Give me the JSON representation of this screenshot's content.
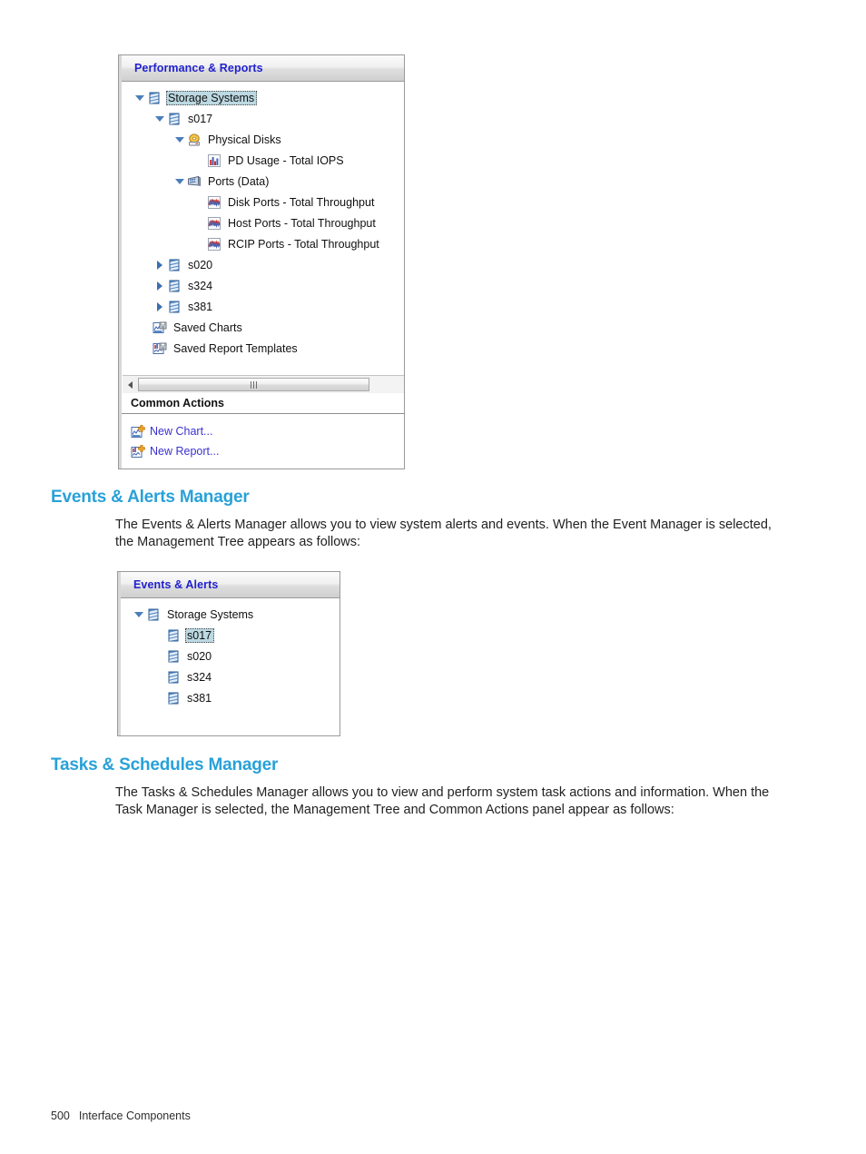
{
  "page": {
    "footer_page_number": "500",
    "footer_chapter": "Interface Components"
  },
  "performance_panel": {
    "header_title": "Performance & Reports",
    "tree": [
      {
        "label": "Storage Systems",
        "depth": 0,
        "state": "open",
        "icon": "storage-system-icon",
        "selected": true
      },
      {
        "label": "s017",
        "depth": 1,
        "state": "open",
        "icon": "storage-system-icon",
        "selected": false
      },
      {
        "label": "Physical Disks",
        "depth": 2,
        "state": "open",
        "icon": "physical-disks-icon",
        "selected": false
      },
      {
        "label": "PD Usage - Total IOPS",
        "depth": 3,
        "state": "leaf",
        "icon": "bar-chart-icon",
        "selected": false
      },
      {
        "label": "Ports (Data)",
        "depth": 2,
        "state": "open",
        "icon": "ports-data-icon",
        "selected": false
      },
      {
        "label": "Disk Ports - Total Throughput",
        "depth": 3,
        "state": "leaf",
        "icon": "line-chart-icon",
        "selected": false
      },
      {
        "label": "Host Ports - Total Throughput",
        "depth": 3,
        "state": "leaf",
        "icon": "line-chart-icon",
        "selected": false
      },
      {
        "label": "RCIP Ports - Total Throughput",
        "depth": 3,
        "state": "leaf",
        "icon": "line-chart-icon",
        "selected": false
      },
      {
        "label": "s020",
        "depth": 1,
        "state": "closed",
        "icon": "storage-system-icon",
        "selected": false
      },
      {
        "label": "s324",
        "depth": 1,
        "state": "closed",
        "icon": "storage-system-icon",
        "selected": false
      },
      {
        "label": "s381",
        "depth": 1,
        "state": "closed",
        "icon": "storage-system-icon",
        "selected": false
      },
      {
        "label": "Saved Charts",
        "depth": 1,
        "state": "leaf-noindent",
        "icon": "saved-charts-icon",
        "selected": false
      },
      {
        "label": "Saved Report Templates",
        "depth": 1,
        "state": "leaf-noindent",
        "icon": "saved-reports-icon",
        "selected": false
      }
    ],
    "common_actions": {
      "title": "Common Actions",
      "items": [
        {
          "label": "New Chart...",
          "icon": "new-chart-icon"
        },
        {
          "label": "New Report...",
          "icon": "new-report-icon"
        }
      ]
    }
  },
  "events_section": {
    "heading": "Events & Alerts Manager",
    "paragraph": "The Events & Alerts Manager allows you to view system alerts and events. When the Event Manager is selected, the Management Tree appears as follows:"
  },
  "events_panel": {
    "header_title": "Events & Alerts",
    "tree": [
      {
        "label": "Storage Systems",
        "depth": 0,
        "state": "open",
        "icon": "storage-system-icon",
        "selected": false
      },
      {
        "label": "s017",
        "depth": 1,
        "state": "leaf",
        "icon": "storage-system-icon",
        "selected": true
      },
      {
        "label": "s020",
        "depth": 1,
        "state": "leaf",
        "icon": "storage-system-icon",
        "selected": false
      },
      {
        "label": "s324",
        "depth": 1,
        "state": "leaf",
        "icon": "storage-system-icon",
        "selected": false
      },
      {
        "label": "s381",
        "depth": 1,
        "state": "leaf",
        "icon": "storage-system-icon",
        "selected": false
      }
    ]
  },
  "tasks_section": {
    "heading": "Tasks & Schedules Manager",
    "paragraph": "The Tasks & Schedules Manager allows you to view and perform system task actions and information. When the Task Manager is selected, the Management Tree and Common Actions panel appear as follows:"
  },
  "colors": {
    "heading_blue": "#29a1d8",
    "panel_title_blue": "#2121cf",
    "link_purple": "#3a31d0",
    "selection_blue": "#bcd9e2"
  }
}
